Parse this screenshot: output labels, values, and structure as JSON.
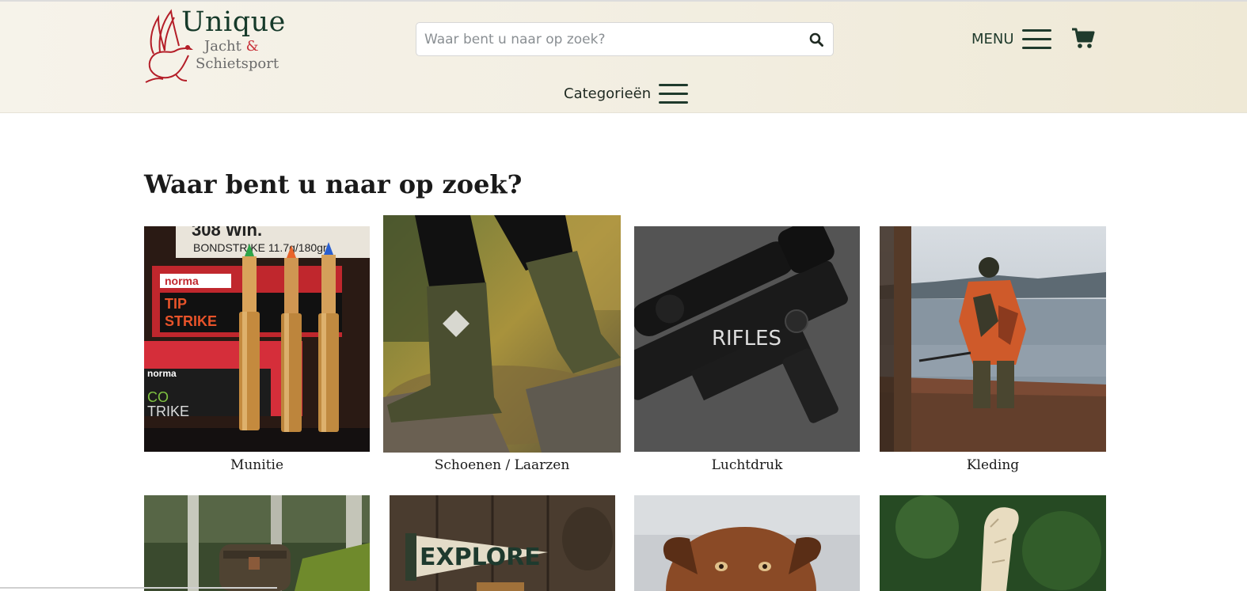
{
  "header": {
    "logo": {
      "title": "Unique",
      "line1": "Jacht",
      "amp": "&",
      "line2": "Schietsport"
    },
    "search": {
      "placeholder": "Waar bent u naar op zoek?"
    },
    "menu_label": "MENU",
    "categories_label": "Categorieën"
  },
  "main": {
    "heading": "Waar bent u naar op zoek?",
    "categories": [
      {
        "name": "Munitie",
        "image": "ammunition-cartridges"
      },
      {
        "name": "Schoenen / Laarzen",
        "image": "rubber-boots"
      },
      {
        "name": "Luchtdruk",
        "image": "air-rifle",
        "overlay": "RIFLES"
      },
      {
        "name": "Kleding",
        "image": "hunter-lake"
      },
      {
        "name": "",
        "image": "bag-forest"
      },
      {
        "name": "",
        "image": "explore-pennant",
        "overlay": "EXPLORE"
      },
      {
        "name": "",
        "image": "dog"
      },
      {
        "name": "",
        "image": "knife"
      }
    ]
  },
  "colors": {
    "brand_green": "#163a2a",
    "brand_red": "#c8323a",
    "header_bg": "#f3efe3"
  }
}
